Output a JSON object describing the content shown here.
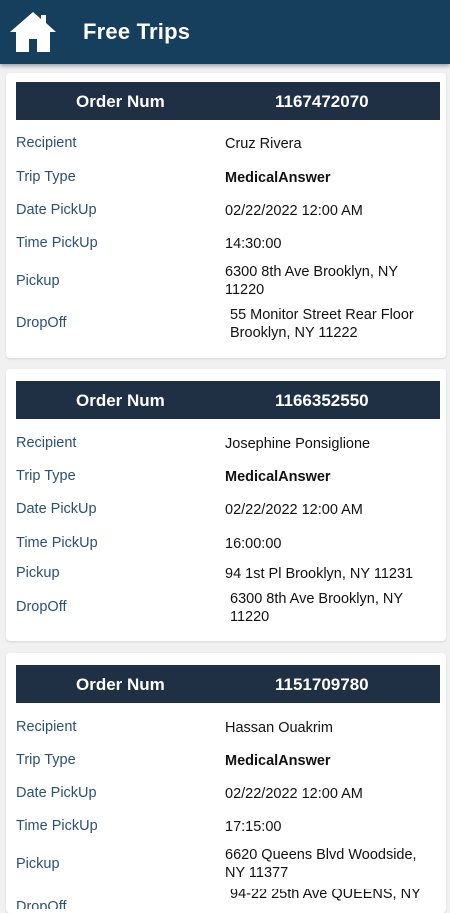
{
  "header": {
    "title": "Free Trips",
    "home_icon": "home-icon"
  },
  "labels": {
    "order_num": "Order Num",
    "recipient": "Recipient",
    "trip_type": "Trip Type",
    "date_pickup": "Date PickUp",
    "time_pickup": "Time PickUp",
    "pickup": "Pickup",
    "dropoff": "DropOff"
  },
  "trips": [
    {
      "order_num": "1167472070",
      "recipient": "Cruz Rivera",
      "trip_type": "MedicalAnswer",
      "date_pickup": "02/22/2022 12:00 AM",
      "time_pickup": "14:30:00",
      "pickup": "6300 8th Ave Brooklyn, NY 11220",
      "dropoff": "55 Monitor Street Rear Floor Brooklyn, NY 11222"
    },
    {
      "order_num": "1166352550",
      "recipient": "Josephine Ponsiglione",
      "trip_type": "MedicalAnswer",
      "date_pickup": "02/22/2022 12:00 AM",
      "time_pickup": "16:00:00",
      "pickup": "94 1st Pl Brooklyn, NY 11231",
      "dropoff": "6300 8th Ave Brooklyn, NY 11220"
    },
    {
      "order_num": "1151709780",
      "recipient": "Hassan Ouakrim",
      "trip_type": "MedicalAnswer",
      "date_pickup": "02/22/2022 12:00 AM",
      "time_pickup": "17:15:00",
      "pickup": "6620 Queens Blvd Woodside, NY 11377",
      "dropoff": "94-22 25th Ave QUEENS, NY"
    }
  ]
}
